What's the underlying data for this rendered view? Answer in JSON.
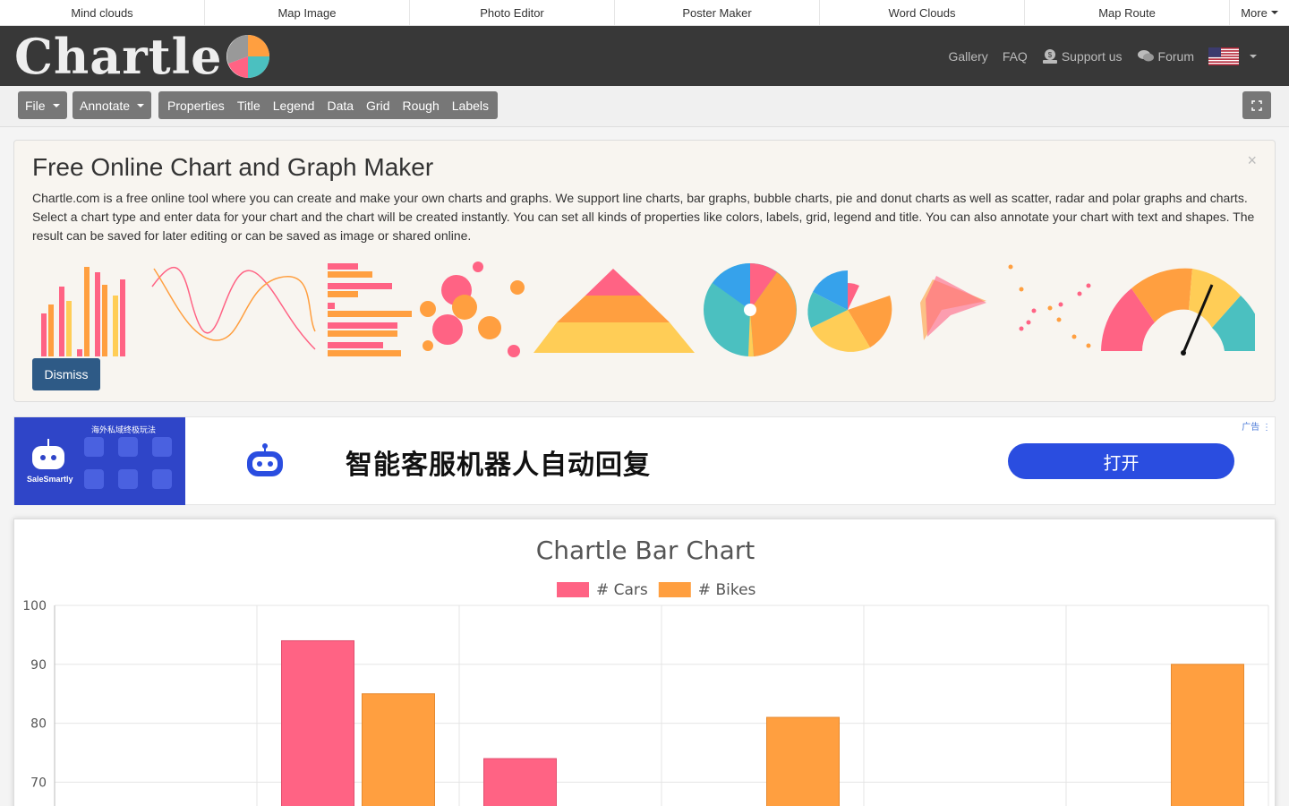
{
  "topnav": {
    "items": [
      "Mind clouds",
      "Map Image",
      "Photo Editor",
      "Poster Maker",
      "Word Clouds",
      "Map Route"
    ],
    "more": "More"
  },
  "header": {
    "logo": "Chartle",
    "links": {
      "gallery": "Gallery",
      "faq": "FAQ",
      "support": "Support us",
      "forum": "Forum"
    }
  },
  "toolbar": {
    "file": "File",
    "annotate": "Annotate",
    "tabs": [
      "Properties",
      "Title",
      "Legend",
      "Data",
      "Grid",
      "Rough",
      "Labels"
    ]
  },
  "intro": {
    "title": "Free Online Chart and Graph Maker",
    "text": "Chartle.com is a free online tool where you can create and make your own charts and graphs. We support line charts, bar graphs, bubble charts, pie and donut charts as well as scatter, radar and polar graphs and charts. Select a chart type and enter data for your chart and the chart will be created instantly. You can set all kinds of properties like colors, labels, grid, legend and title. You can also annotate your chart with text and shapes. The result can be saved for later editing or can be saved as image or shared online.",
    "dismiss": "Dismiss",
    "close": "×"
  },
  "ad": {
    "headline": "智能客服机器人自动回复",
    "button": "打开",
    "tag": "广告",
    "image_heading": "海外私域终极玩法",
    "image_brand": "SaleSmartly"
  },
  "colors": {
    "pink": "#ff6384",
    "orange": "#ff9f40",
    "yellow": "#ffcd56",
    "teal": "#4bc0c0",
    "blue": "#36a2eb"
  },
  "chart_data": {
    "type": "bar",
    "title": "Chartle Bar Chart",
    "series": [
      {
        "name": "# Cars",
        "color": "#ff6384",
        "values": [
          null,
          94,
          74,
          null,
          null,
          null
        ]
      },
      {
        "name": "# Bikes",
        "color": "#ff9f40",
        "values": [
          null,
          85,
          null,
          81,
          null,
          90
        ]
      }
    ],
    "yticks": [
      100,
      90,
      80,
      70
    ],
    "ylim": [
      67.1,
      100
    ],
    "grid": true,
    "legend": "top"
  }
}
